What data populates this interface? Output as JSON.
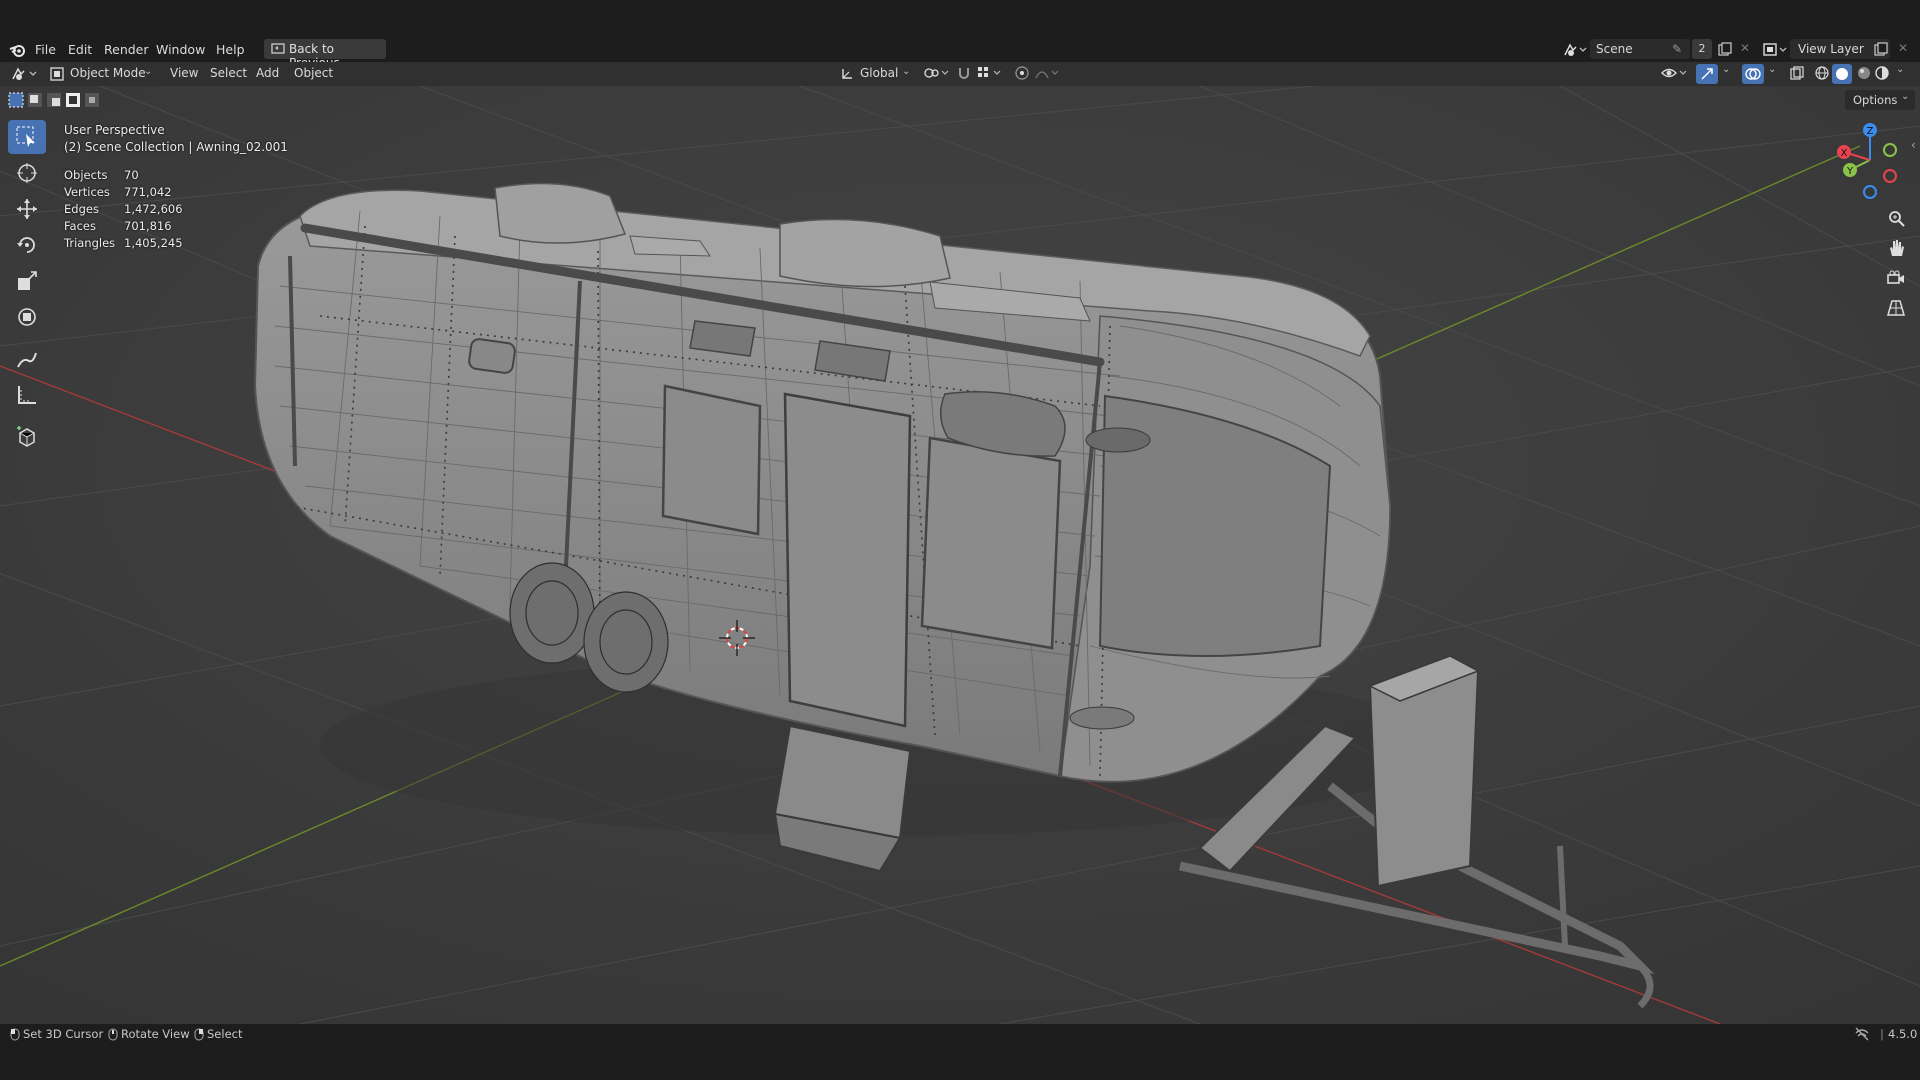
{
  "app": {
    "name": "Blender",
    "version": "4.5.0"
  },
  "menu": [
    "File",
    "Edit",
    "Render",
    "Window",
    "Help"
  ],
  "back_button": "Back to Previous",
  "scene": {
    "name": "Scene",
    "count": "2"
  },
  "view_layer": "View Layer",
  "header": {
    "mode": "Object Mode",
    "menus": [
      "View",
      "Select",
      "Add",
      "Object"
    ],
    "transform_orientation": "Global"
  },
  "viewport": {
    "perspective": "User Perspective",
    "collection_info": "(2) Scene Collection | Awning_02.001",
    "options_label": "Options",
    "stats": [
      {
        "label": "Objects",
        "value": "70"
      },
      {
        "label": "Vertices",
        "value": "771,042"
      },
      {
        "label": "Edges",
        "value": "1,472,606"
      },
      {
        "label": "Faces",
        "value": "701,816"
      },
      {
        "label": "Triangles",
        "value": "1,405,245"
      }
    ],
    "gizmo_axes": {
      "x": "X",
      "y": "Y",
      "z": "Z"
    }
  },
  "tools": [
    "select-box",
    "cursor",
    "move",
    "rotate",
    "scale",
    "transform",
    "annotate",
    "measure",
    "add-cube"
  ],
  "statusbar": {
    "items": [
      "Set 3D Cursor",
      "Rotate View",
      "Select"
    ],
    "version": "4.5.0"
  },
  "colors": {
    "accent": "#4772b3",
    "x_axis": "#e8434f",
    "y_axis": "#8bc34a",
    "z_axis": "#3a8cf0",
    "viewport_bg": "#3d3d3d"
  }
}
